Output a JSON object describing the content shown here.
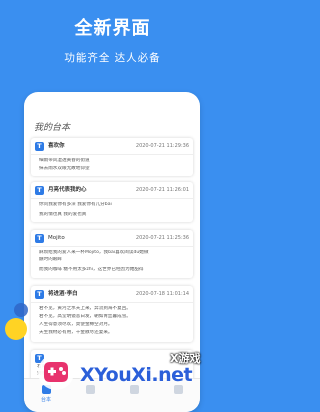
{
  "promo": {
    "headline": "全新界面",
    "subline": "功能齐全 达人必备"
  },
  "app": {
    "screen_title": "我的台本",
    "cards": [
      {
        "icon_letter": "T",
        "title": "喜欢你",
        "time": "2020-07-21 11:29:36",
        "lines": [
          "细雨带风湿透黄昏的街道",
          "抹去雨水双眼无故地仰望"
        ]
      },
      {
        "icon_letter": "T",
        "title": "月亮代表我的心",
        "time": "2020-07-21 11:26:01",
        "lines": [
          "你问我爱你有多深  我爱你有几分bai",
          "我的情也真  我的爱也真"
        ]
      },
      {
        "icon_letter": "T",
        "title": "Mojito",
        "time": "2020-07-21 11:25:36",
        "lines": [
          "麻烦给我的爱人来一杯Mojito，我bai喜欢阅读du她微",
          "醺时的眼眸",
          "而我的咖啡 糖不用太多zhi，这世界已经因为她甜得"
        ]
      },
      {
        "icon_letter": "T",
        "title": "将进酒·李白",
        "time": "2020-07-18 11:01:14",
        "lines": [
          "君不见，黄河之水天上来，奔流到海不复回。",
          "君不见，高堂明镜悲白发，朝如青丝暮成雪。",
          "人生得意须尽欢，莫使金樽空对月。",
          "天生我材必有用，千金散尽还复来。"
        ]
      },
      {
        "icon_letter": "T",
        "title": "",
        "time": "",
        "lines": [
          "若问",
          "到底"
        ]
      }
    ],
    "nav": [
      {
        "label": "台本",
        "active": true
      },
      {
        "label": "",
        "active": false
      },
      {
        "label": "",
        "active": false
      },
      {
        "label": "",
        "active": false
      }
    ]
  },
  "watermark": {
    "brand": "X游戏",
    "site": "XYouXi.net"
  },
  "colors": {
    "background": "#3a8ff0",
    "accent": "#2e7be6",
    "blob_yellow": "#ffd324"
  }
}
